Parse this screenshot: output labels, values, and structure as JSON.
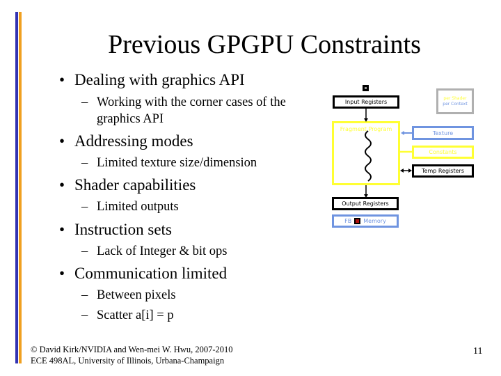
{
  "slide": {
    "title": "Previous GPGPU Constraints",
    "bullets": [
      {
        "text": "Dealing with graphics API",
        "sub": [
          "Working with the corner cases of the",
          "graphics API"
        ]
      },
      {
        "text": "Addressing modes",
        "sub": [
          "Limited texture size/dimension"
        ]
      },
      {
        "text": "Shader capabilities",
        "sub": [
          "Limited outputs"
        ]
      },
      {
        "text": "Instruction sets",
        "sub": [
          "Lack of Integer & bit ops"
        ]
      },
      {
        "text": "Communication limited",
        "sub": [
          "Between pixels",
          "Scatter  a[i] = p"
        ]
      }
    ],
    "bullet_glyph": "•",
    "dash_glyph": "–",
    "footer_line1": "© David Kirk/NVIDIA and Wen-mei W. Hwu, 2007-2010",
    "footer_line2": "ECE 498AL, University of Illinois, Urbana-Champaign",
    "page_number": "11"
  },
  "diagram": {
    "input_registers": "Input Registers",
    "fragment_program": "Fragment Program",
    "texture": "Texture",
    "constants": "Constants",
    "temp_registers": "Temp Registers",
    "output_registers": "Output Registers",
    "fb": "FB",
    "memory": "Memory",
    "legend_per_shader": "per Shader",
    "legend_per_context": "per Context",
    "colors": {
      "per_shader": "#ffff33",
      "per_context": "#6f94e0",
      "accent_blue": "#3333b3",
      "accent_orange": "#f0a020"
    }
  }
}
